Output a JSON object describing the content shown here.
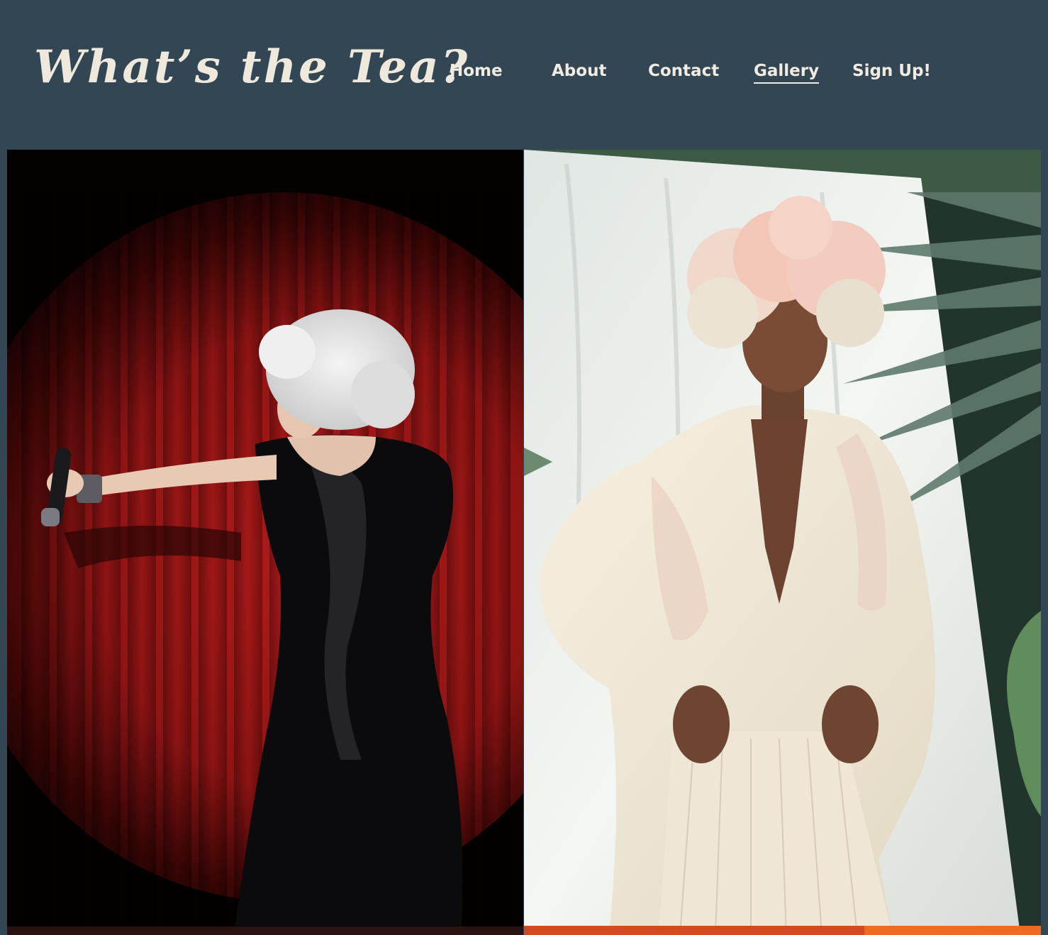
{
  "site": {
    "logo_text": "What’s the Tea?"
  },
  "nav": {
    "items": [
      {
        "label": "Home",
        "active": false
      },
      {
        "label": "About",
        "active": false
      },
      {
        "label": "Contact",
        "active": false
      },
      {
        "label": "Gallery",
        "active": true
      },
      {
        "label": "Sign Up!",
        "active": false
      }
    ]
  },
  "colors": {
    "header_bg": "#324654",
    "nav_text": "#f1ebe1",
    "logo_text": "#efe8dc"
  },
  "gallery": {
    "photos": [
      {
        "subject": "drag performer in black sequin gown on red-curtain stage with microphone"
      },
      {
        "subject": "model in cream coat with pink flower headpiece before white drape and palm leaves"
      }
    ]
  }
}
